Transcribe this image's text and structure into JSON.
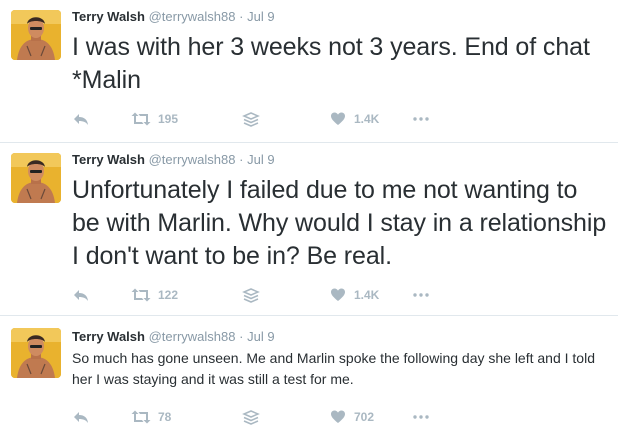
{
  "tweets": [
    {
      "author_name": "Terry Walsh",
      "handle": "@terrywalsh88",
      "separator": "·",
      "date": "Jul 9",
      "text": "I was with her 3 weeks not 3 years. End of chat *Malin",
      "retweets": "195",
      "likes": "1.4K"
    },
    {
      "author_name": "Terry Walsh",
      "handle": "@terrywalsh88",
      "separator": "·",
      "date": "Jul 9",
      "text": "Unfortunately I failed due to me not wanting to be with Marlin. Why would I stay in a relationship I don't want to be in? Be real.",
      "retweets": "122",
      "likes": "1.4K"
    },
    {
      "author_name": "Terry Walsh",
      "handle": "@terrywalsh88",
      "separator": "·",
      "date": "Jul 9",
      "text": "So much has gone unseen. Me and Marlin spoke the following day she left and I told her I was staying and it was still a test for me.",
      "retweets": "78",
      "likes": "702"
    }
  ],
  "icons": {
    "reply": "reply-icon",
    "retweet": "retweet-icon",
    "cloud": "cloud-icon",
    "like": "heart-icon",
    "more": "more-icon"
  },
  "colors": {
    "action_gray": "#aab8c2",
    "secondary_text": "#8899a6",
    "primary_text": "#292f33",
    "divider": "#e1e8ed",
    "avatar_bg": "#e9b22e"
  }
}
